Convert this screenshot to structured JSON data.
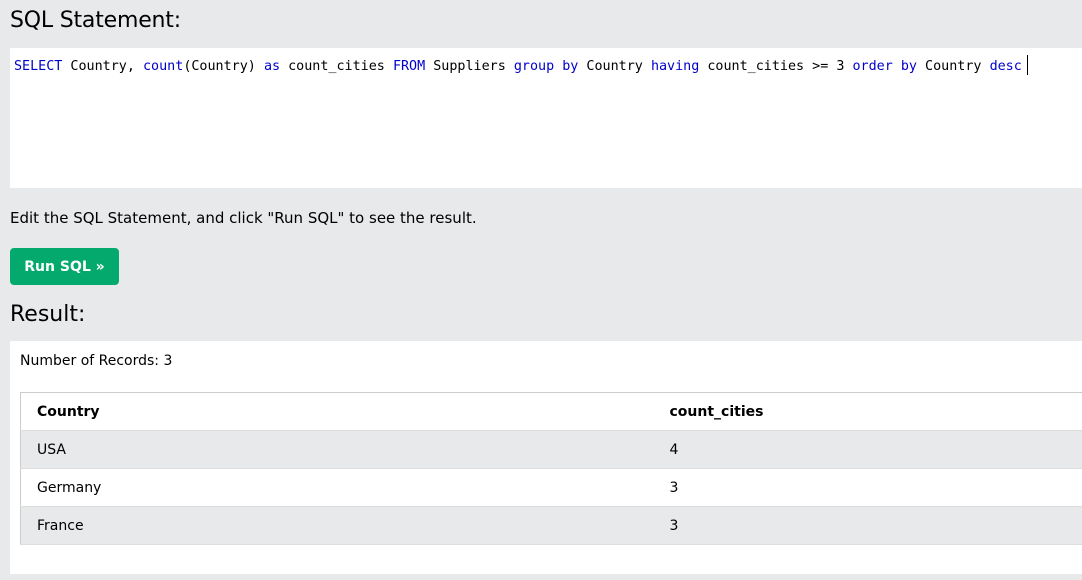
{
  "sql_heading": "SQL Statement:",
  "editor": {
    "tokens": [
      {
        "text": "SELECT",
        "kw": true
      },
      {
        "text": " Country, ",
        "kw": false
      },
      {
        "text": "count",
        "kw": true
      },
      {
        "text": "(Country) ",
        "kw": false
      },
      {
        "text": "as",
        "kw": true
      },
      {
        "text": " count_cities ",
        "kw": false
      },
      {
        "text": "FROM",
        "kw": true
      },
      {
        "text": " Suppliers ",
        "kw": false
      },
      {
        "text": "group by",
        "kw": true
      },
      {
        "text": " Country ",
        "kw": false
      },
      {
        "text": "having",
        "kw": true
      },
      {
        "text": " count_cities >= 3 ",
        "kw": false
      },
      {
        "text": "order by",
        "kw": true
      },
      {
        "text": " Country ",
        "kw": false
      },
      {
        "text": "desc",
        "kw": true
      }
    ]
  },
  "hint": "Edit the SQL Statement, and click \"Run SQL\" to see the result.",
  "run_button": "Run SQL »",
  "result_heading": "Result:",
  "records_label": "Number of Records: 3",
  "table": {
    "headers": [
      "Country",
      "count_cities"
    ],
    "rows": [
      [
        "USA",
        "4"
      ],
      [
        "Germany",
        "3"
      ],
      [
        "France",
        "3"
      ]
    ]
  },
  "colors": {
    "button": "#04aa6d",
    "keyword": "#0000cd",
    "background": "#e7e9eb"
  }
}
